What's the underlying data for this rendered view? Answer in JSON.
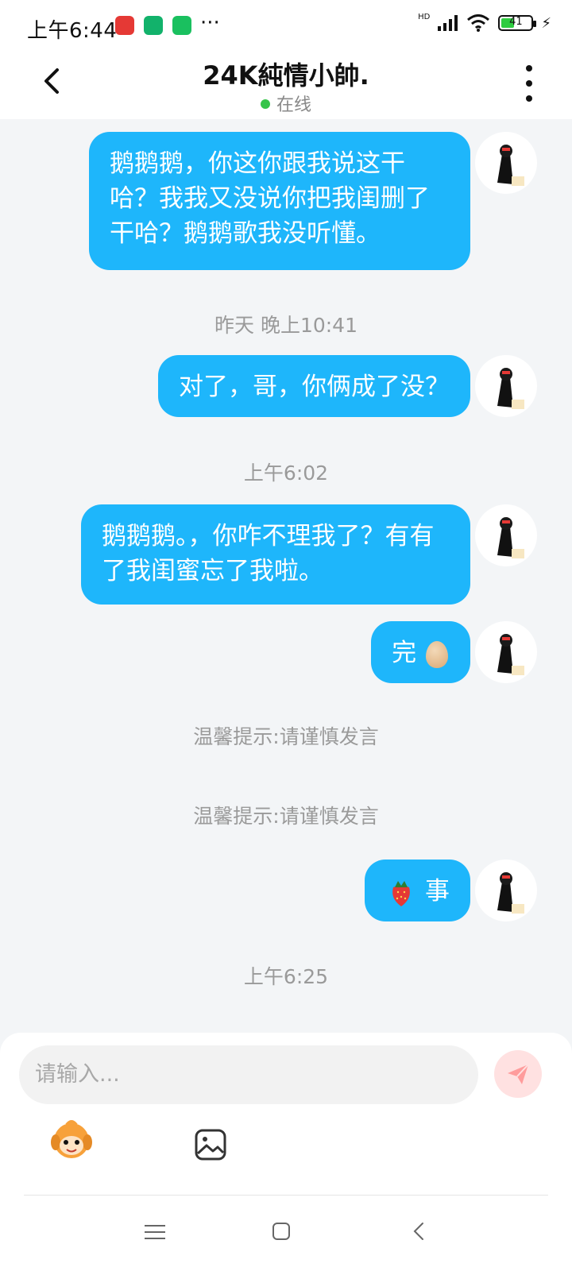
{
  "status_bar": {
    "time": "上午6:44",
    "battery": "41",
    "network": "HD"
  },
  "header": {
    "title": "24K純情小帥.",
    "presence": "在线"
  },
  "messages": [
    {
      "text": "鹅鹅鹅，你这你跟我说这干哈？我我又没说你把我闺删了干哈？鹅鹅歌我没听懂。"
    },
    {
      "text": "对了，哥，你俩成了没？"
    },
    {
      "text": "鹅鹅鹅。，你咋不理我了？有有了我闺蜜忘了我啦。"
    },
    {
      "text": "完",
      "emoji": "egg-emoji"
    },
    {
      "text": "事",
      "emoji": "strawberry-emoji"
    }
  ],
  "timestamps": [
    "昨天 晚上10:41",
    "上午6:02",
    "上午6:25"
  ],
  "notices": [
    "温馨提示:请谨慎发言",
    "温馨提示:请谨慎发言"
  ],
  "composer": {
    "placeholder": "请输入..."
  },
  "colors": {
    "bubble": "#1eb6fb",
    "background": "#f3f5f7",
    "send_bg": "#ffe1e1",
    "send_icon": "#ff9c9c",
    "online": "#36c44a"
  }
}
